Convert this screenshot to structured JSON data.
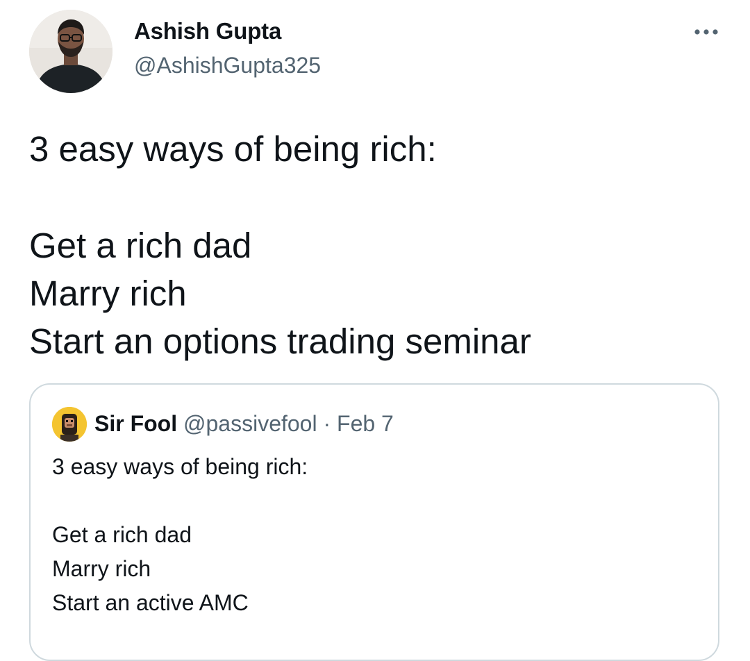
{
  "author": {
    "name": "Ashish Gupta",
    "handle": "@AshishGupta325"
  },
  "more_menu": {
    "icon": "more-horizontal-icon"
  },
  "tweet": {
    "lines": [
      "3 easy ways of being rich:",
      "",
      "Get a rich dad",
      "Marry rich",
      "Start an options trading seminar"
    ]
  },
  "quoted_tweet": {
    "author_name": "Sir Fool",
    "author_handle": "@passivefool",
    "separator": "·",
    "date": "Feb 7",
    "lines": [
      "3 easy ways of being rich:",
      "",
      "Get a rich dad",
      "Marry rich",
      "Start an active AMC"
    ]
  },
  "colors": {
    "text_primary": "#0f1419",
    "text_secondary": "#536471",
    "card_border": "#cfd9de",
    "quote_avatar_bg": "#f4c430"
  }
}
